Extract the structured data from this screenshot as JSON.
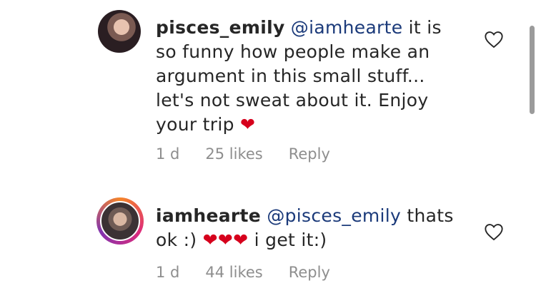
{
  "comments": [
    {
      "username": "pisces_emily",
      "mention": "@iamhearte",
      "text": " it is so funny how people make an argument in this small stuff... let's not sweat about it. Enjoy your trip ",
      "emoji": "❤",
      "time": "1 d",
      "likes": "25 likes",
      "reply": "Reply"
    },
    {
      "username": "iamhearte",
      "mention": "@pisces_emily",
      "text": " thats ok :) ",
      "emoji": "❤❤❤",
      "text_after": " i get it:)",
      "time": "1 d",
      "likes": "44 likes",
      "reply": "Reply"
    }
  ],
  "icons": {
    "like": "heart-outline-icon"
  },
  "colors": {
    "mention": "#1b3a7a",
    "meta": "#8e8e8e",
    "heart": "#d6001c"
  }
}
